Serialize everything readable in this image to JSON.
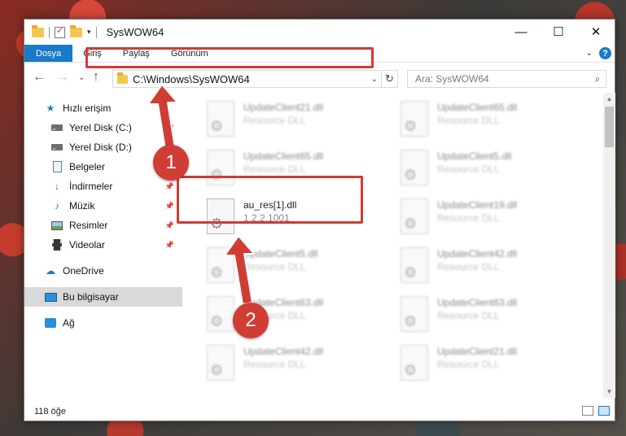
{
  "window": {
    "title": "SysWOW64",
    "controls": {
      "minimize": "—",
      "maximize": "☐",
      "close": "✕"
    }
  },
  "ribbon": {
    "tabs": [
      "Dosya",
      "Giriş",
      "Paylaş",
      "Görünüm"
    ],
    "help_label": "?"
  },
  "address_bar": {
    "path": "C:\\Windows\\SysWOW64",
    "search_placeholder": "Ara: SysWOW64"
  },
  "sidebar": {
    "items": [
      {
        "label": "Hızlı erişim",
        "icon": "star-icon",
        "pinned": false
      },
      {
        "label": "Yerel Disk (C:)",
        "icon": "drive-icon",
        "pinned": true
      },
      {
        "label": "Yerel Disk (D:)",
        "icon": "drive-icon",
        "pinned": true
      },
      {
        "label": "Belgeler",
        "icon": "documents-icon",
        "pinned": true
      },
      {
        "label": "İndirmeler",
        "icon": "download-icon",
        "pinned": true
      },
      {
        "label": "Müzik",
        "icon": "music-icon",
        "pinned": true
      },
      {
        "label": "Resimler",
        "icon": "pictures-icon",
        "pinned": true
      },
      {
        "label": "Videolar",
        "icon": "videos-icon",
        "pinned": true
      },
      {
        "label": "OneDrive",
        "icon": "cloud-icon",
        "pinned": false
      },
      {
        "label": "Bu bilgisayar",
        "icon": "computer-icon",
        "pinned": false,
        "selected": true
      },
      {
        "label": "Ağ",
        "icon": "network-icon",
        "pinned": false
      }
    ]
  },
  "files": {
    "left_column": [
      {
        "name": "UpdateClient21.dll",
        "sub": "Resource DLL",
        "blurred": true
      },
      {
        "name": "UpdateClient65.dll",
        "sub": "Resource DLL",
        "blurred": true
      },
      {
        "name": "au_res[1].dll",
        "sub": "1.2.2.1001",
        "blurred": false
      },
      {
        "name": "UpdateClient5.dll",
        "sub": "Resource DLL",
        "blurred": true
      },
      {
        "name": "UpdateClient63.dll",
        "sub": "Resource DLL",
        "blurred": true
      },
      {
        "name": "UpdateClient42.dll",
        "sub": "Resource DLL",
        "blurred": true
      }
    ],
    "right_column": [
      {
        "name": "UpdateClient65.dll",
        "sub": "Resource DLL",
        "blurred": true
      },
      {
        "name": "UpdateClient5.dll",
        "sub": "Resource DLL",
        "blurred": true
      },
      {
        "name": "UpdateClient19.dll",
        "sub": "Resource DLL",
        "blurred": true
      },
      {
        "name": "UpdateClient42.dll",
        "sub": "Resource DLL",
        "blurred": true
      },
      {
        "name": "UpdateClient63.dll",
        "sub": "Resource DLL",
        "blurred": true
      },
      {
        "name": "UpdateClient21.dll",
        "sub": "Resource DLL",
        "blurred": true
      }
    ]
  },
  "status_bar": {
    "item_count": "118 öğe"
  },
  "annotations": {
    "step1": "1",
    "step2": "2",
    "accent_color": "#cf3d35"
  }
}
